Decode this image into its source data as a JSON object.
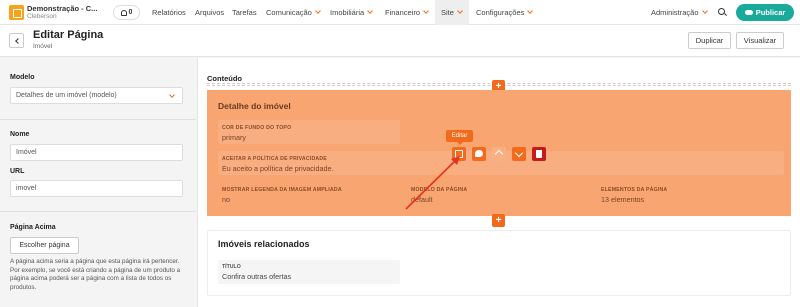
{
  "topbar": {
    "brand_title": "Demonstração - C...",
    "brand_user": "Cleberson",
    "notifications_count": "0",
    "nav": [
      "Relatórios",
      "Arquivos",
      "Tarefas",
      "Comunicação",
      "Imobiliária",
      "Financeiro",
      "Site",
      "Configurações"
    ],
    "admin_label": "Administração",
    "publish_label": "Publicar"
  },
  "header": {
    "title": "Editar Página",
    "subtitle": "Imóvel",
    "duplicate_label": "Duplicar",
    "view_label": "Visualizar"
  },
  "sidebar": {
    "model_label": "Modelo",
    "model_value": "Detalhes de um imóvel (modelo)",
    "name_label": "Nome",
    "name_value": "Imóvel",
    "url_label": "URL",
    "url_value": "imovel",
    "parent_label": "Página Acima",
    "choose_label": "Escolher página",
    "help_text": "A página acima seria a página que esta página irá pertencer. Por exemplo, se você está criando a página de um produto a página acima poderá ser a página com a lista de todos os produtos."
  },
  "content": {
    "section_label": "Conteúdo",
    "block1": {
      "title": "Detalhe do imóvel",
      "bg_label": "COR DE FUNDO DO TOPO",
      "bg_value": "primary",
      "privacy_label": "ACEITAR A POLÍTICA DE PRIVACIDADE",
      "privacy_value": "Eu aceito a política de privacidade.",
      "legend_label": "MOSTRAR LEGENDA DA IMAGEM AMPLIADA",
      "legend_value": "no",
      "model_label": "MODELO DA PÁGINA",
      "model_value": "default",
      "elements_label": "ELEMENTOS DA PÁGINA",
      "elements_value": "13 elementos"
    },
    "tooltip": "Editar",
    "block2": {
      "title": "Imóveis relacionados",
      "title_label": "TÍTULO",
      "title_value": "Confira outras ofertas"
    }
  },
  "colors": {
    "accent": "#f26b1d",
    "publish": "#1aaa9c",
    "block_bg": "#f8a572",
    "delete": "#c41b1b"
  }
}
